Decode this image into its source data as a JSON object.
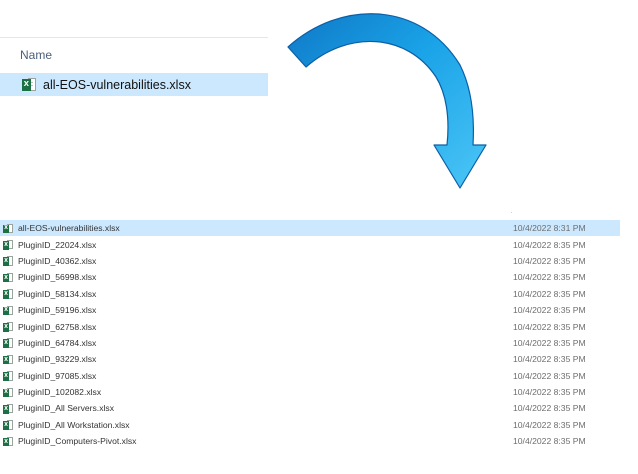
{
  "top": {
    "column_header": "Name",
    "file": {
      "name": "all-EOS-vulnerabilities.xlsx",
      "icon": "excel-file-icon",
      "selected": true
    }
  },
  "arrow": {
    "icon": "curved-arrow-icon",
    "color": "#1aa3e8"
  },
  "files": [
    {
      "name": "all-EOS-vulnerabilities.xlsx",
      "date": "10/4/2022 8:31 PM",
      "selected": true
    },
    {
      "name": "PluginID_22024.xlsx",
      "date": "10/4/2022 8:35 PM",
      "selected": false
    },
    {
      "name": "PluginID_40362.xlsx",
      "date": "10/4/2022 8:35 PM",
      "selected": false
    },
    {
      "name": "PluginID_56998.xlsx",
      "date": "10/4/2022 8:35 PM",
      "selected": false
    },
    {
      "name": "PluginID_58134.xlsx",
      "date": "10/4/2022 8:35 PM",
      "selected": false
    },
    {
      "name": "PluginID_59196.xlsx",
      "date": "10/4/2022 8:35 PM",
      "selected": false
    },
    {
      "name": "PluginID_62758.xlsx",
      "date": "10/4/2022 8:35 PM",
      "selected": false
    },
    {
      "name": "PluginID_64784.xlsx",
      "date": "10/4/2022 8:35 PM",
      "selected": false
    },
    {
      "name": "PluginID_93229.xlsx",
      "date": "10/4/2022 8:35 PM",
      "selected": false
    },
    {
      "name": "PluginID_97085.xlsx",
      "date": "10/4/2022 8:35 PM",
      "selected": false
    },
    {
      "name": "PluginID_102082.xlsx",
      "date": "10/4/2022 8:35 PM",
      "selected": false
    },
    {
      "name": "PluginID_All Servers.xlsx",
      "date": "10/4/2022 8:35 PM",
      "selected": false
    },
    {
      "name": "PluginID_All Workstation.xlsx",
      "date": "10/4/2022 8:35 PM",
      "selected": false
    },
    {
      "name": "PluginID_Computers-Pivot.xlsx",
      "date": "10/4/2022 8:35 PM",
      "selected": false
    }
  ],
  "icons": {
    "excel_badge": "X",
    "excel_color": "#1d7044",
    "selection_color": "#cce8ff"
  }
}
